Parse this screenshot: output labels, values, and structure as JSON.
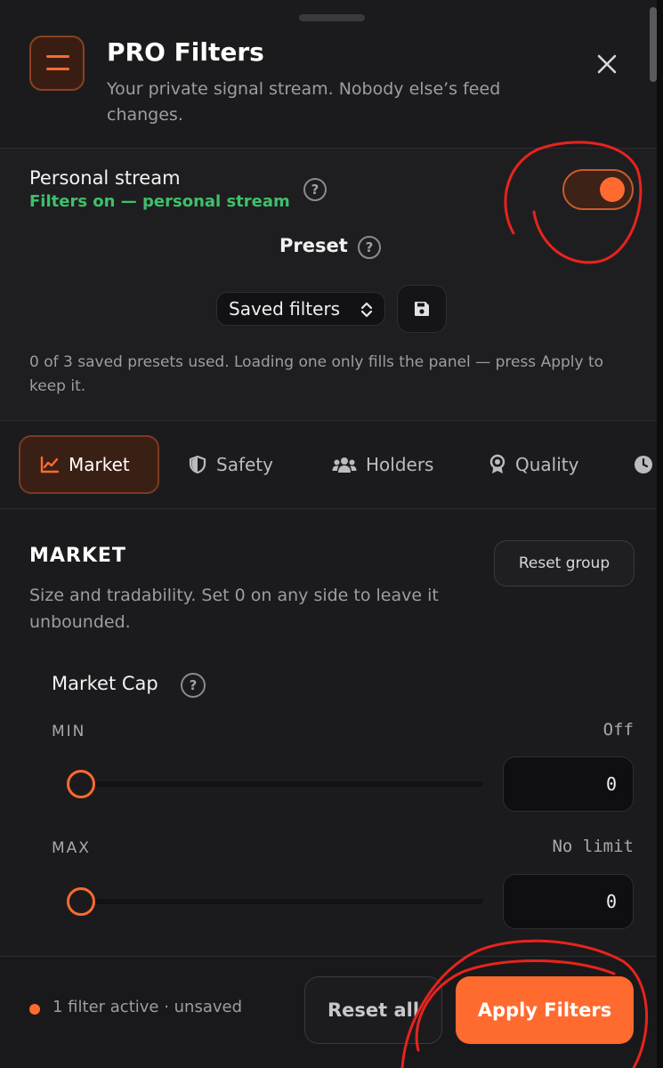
{
  "header": {
    "title": "PRO Filters",
    "subtitle": "Your private signal stream. Nobody else’s feed changes.",
    "close_icon": "close-icon"
  },
  "stream": {
    "label": "Personal stream",
    "status": "Filters on — personal stream",
    "status_color": "#3ec06b",
    "help": "?",
    "toggle_on": true
  },
  "preset": {
    "label": "Preset",
    "help": "?",
    "select_value": "Saved filters",
    "note": "0 of 3 saved presets used. Loading one only fills the panel — press Apply to keep it."
  },
  "tabs": [
    {
      "label": "Market",
      "icon": "chart-line-icon",
      "active": true
    },
    {
      "label": "Safety",
      "icon": "shield-icon",
      "active": false
    },
    {
      "label": "Holders",
      "icon": "users-icon",
      "active": false
    },
    {
      "label": "Quality",
      "icon": "award-icon",
      "active": false
    },
    {
      "label": "",
      "icon": "clock-icon",
      "active": false
    }
  ],
  "market": {
    "title": "MARKET",
    "reset_label": "Reset group",
    "description": "Size and tradability. Set 0 on any side to leave it unbounded.",
    "market_cap": {
      "label": "Market Cap",
      "help": "?",
      "min": {
        "label": "MIN",
        "value_text": "Off",
        "input_value": "0",
        "slider_fraction": 0
      },
      "max": {
        "label": "MAX",
        "value_text": "No limit",
        "input_value": "0",
        "slider_fraction": 0
      }
    }
  },
  "footer": {
    "status": "1 filter active · unsaved",
    "reset_all_label": "Reset all",
    "apply_label": "Apply Filters"
  },
  "colors": {
    "accent": "#ff6a2f",
    "background": "#1b1b1d",
    "success": "#3ec06b"
  }
}
